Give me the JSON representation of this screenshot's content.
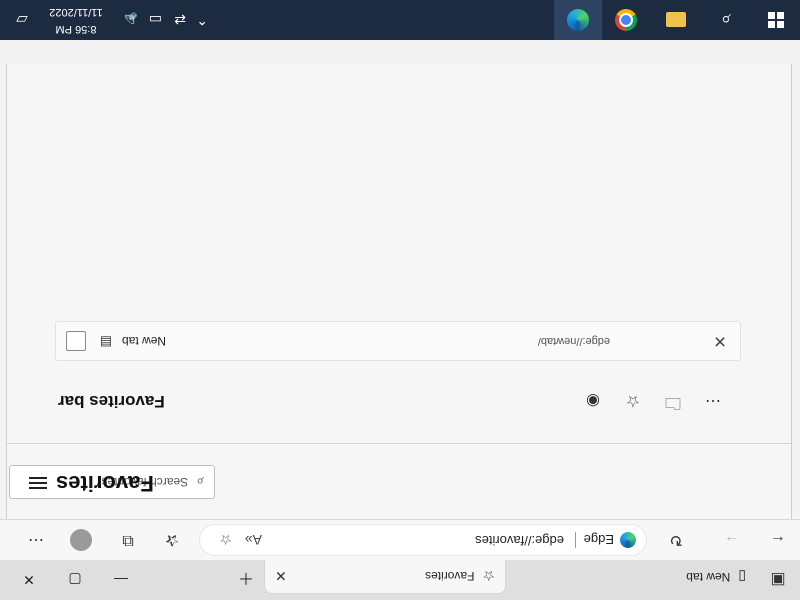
{
  "tabs": [
    {
      "label": "New tab",
      "active": false
    },
    {
      "label": "Favorites",
      "active": true
    }
  ],
  "window_controls": {
    "minimize": "—",
    "maximize": "▢",
    "close": "✕"
  },
  "address_bar": {
    "site_label": "Edge",
    "url": "edge://favorites"
  },
  "favorites_panel": {
    "title": "Favorites",
    "search_placeholder": "Search favorites",
    "folder_title": "Favorites bar",
    "items": [
      {
        "name": "New tab",
        "url": "edge://newtab/"
      }
    ]
  },
  "taskbar": {
    "time": "8:56 PM",
    "date": "11/11/2022",
    "colors": {
      "taskbar": "#1c2b3f",
      "active": "#2e4361"
    }
  },
  "icons": [
    "window-icon",
    "new-tab-icon",
    "favorites-icon",
    "back-icon",
    "forward-icon",
    "refresh-icon",
    "edge-logo-icon",
    "read-aloud-icon",
    "add-favorite-icon",
    "favorites-toolbar-icon",
    "collections-icon",
    "profile-avatar",
    "more-icon",
    "menu-icon",
    "search-icon",
    "hide-icon",
    "add-folder-icon",
    "tab-icon",
    "close-icon",
    "windows-start-icon",
    "search-tool-icon",
    "file-explorer-icon",
    "chrome-icon",
    "edge-icon",
    "chevron-up-icon",
    "network-icon",
    "battery-icon",
    "volume-icon",
    "notification-icon"
  ]
}
